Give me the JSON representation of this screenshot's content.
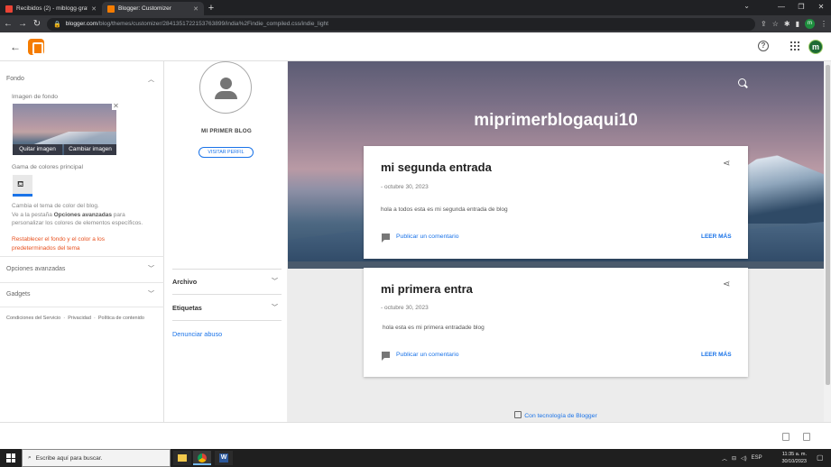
{
  "browser": {
    "tabs": [
      {
        "title": "Recibidos (2) - miblogg·gratisper...",
        "favicon_color": "#ea4335"
      },
      {
        "title": "Blogger: Customizer",
        "favicon_color": "#f57c00"
      }
    ],
    "new_tab": "+",
    "url_host": "blogger.com",
    "url_path": "/blog/themes/customizer/2841351722153763899/india%2Findie_compiled.css/indie_light",
    "profile_initial": "m"
  },
  "header": {
    "avatar_initial": "m"
  },
  "customizer": {
    "fondo": {
      "heading": "Fondo",
      "bg_image_label": "Imagen de fondo",
      "remove_image": "Quitar imagen",
      "change_image": "Cambiar imagen",
      "palette_label": "Gama de colores principal",
      "desc_1": "Cambia el tema de color del blog.",
      "desc_2_pre": "Ve a la pestaña ",
      "desc_2_bold": "Opciones avanzadas",
      "desc_2_post": " para",
      "desc_3": "personalizar los colores de elementos específicos.",
      "reset_1": "Restablecer el fondo y el color a los",
      "reset_2": "predeterminados del tema"
    },
    "advanced": "Opciones avanzadas",
    "gadgets": "Gadgets",
    "footer": {
      "terms": "Condiciones del Servicio",
      "privacy": "Privacidad",
      "content_policy": "Política de contenido",
      "sep": "·"
    }
  },
  "blog": {
    "name": "MI PRIMER BLOG",
    "visit_profile": "VISITAR PERFIL",
    "widgets": [
      "Archivo",
      "Etiquetas"
    ],
    "report_abuse": "Denunciar abuso",
    "hero_title": "miprimerblogaqui10",
    "posts": [
      {
        "title": "mi segunda entrada",
        "date": "- octubre 30, 2023",
        "body": "hola a todos esta es mi segunda entrada de blog",
        "comment": "Publicar un comentario",
        "read_more": "LEER MÁS"
      },
      {
        "title": "mi primera entra",
        "date": "- octubre 30, 2023",
        "body": "hola esta es mi primera entradade blog",
        "comment": "Publicar un comentario",
        "read_more": "LEER MÁS"
      }
    ],
    "powered_by": "Con tecnología de Blogger"
  },
  "taskbar": {
    "search_placeholder": "Escribe aquí para buscar.",
    "lang": "ESP",
    "time": "11:35 a. m.",
    "date": "30/10/2023"
  },
  "colors": {
    "accent_blue": "#1a73e8",
    "blogger_orange": "#f57c00",
    "reset_red": "#e8511f"
  }
}
